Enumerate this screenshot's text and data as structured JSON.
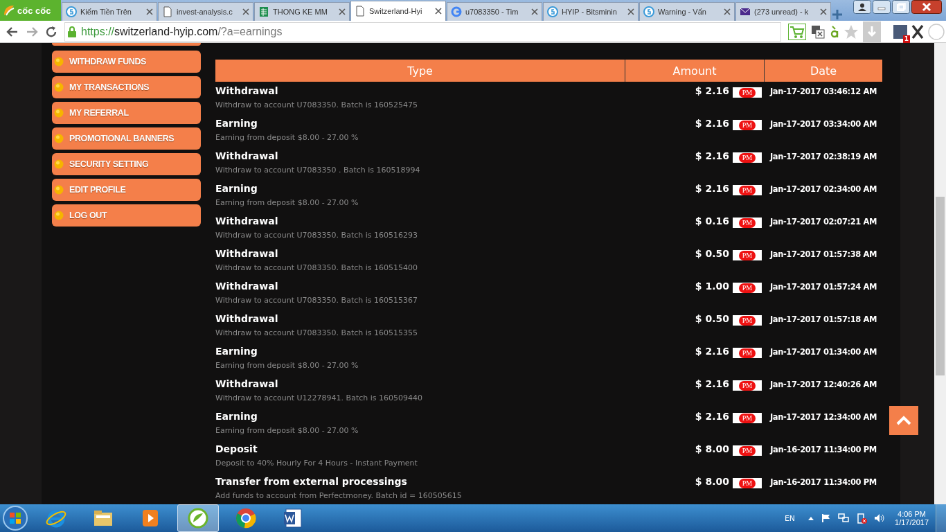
{
  "browser": {
    "logo": "cốc cốc",
    "tabs": [
      {
        "title": "Kiếm Tiền Trên",
        "kind": "coin",
        "selected": false
      },
      {
        "title": "invest-analysis.c",
        "kind": "page",
        "selected": false
      },
      {
        "title": "THONG KE MM",
        "kind": "sheet",
        "selected": false
      },
      {
        "title": "Switzerland-Hyi",
        "kind": "page",
        "selected": true
      },
      {
        "title": "u7083350 - Tim",
        "kind": "google",
        "selected": false
      },
      {
        "title": "HYIP - Bitsminin",
        "kind": "coin",
        "selected": false
      },
      {
        "title": "Warning - Vấn",
        "kind": "coin",
        "selected": false
      },
      {
        "title": "(273 unread) - k",
        "kind": "mail",
        "selected": false
      }
    ],
    "url": {
      "scheme": "https://",
      "host": "switzerland-hyip.com",
      "path": "/?a=earnings"
    },
    "extension_badge": "1"
  },
  "sidebar": {
    "items": [
      "WITHDRAW FUNDS",
      "MY TRANSACTIONS",
      "MY REFERRAL",
      "PROMOTIONAL BANNERS",
      "SECURITY SETTING",
      "EDIT PROFILE",
      "LOG OUT"
    ]
  },
  "table": {
    "columns": [
      "Type",
      "Amount",
      "Date"
    ],
    "rows": [
      {
        "type": "Withdrawal",
        "description": "Withdraw to account U7083350. Batch is 160525475",
        "amount": "$ 2.16",
        "method": "PM",
        "date": "Jan-17-2017 03:46:12 AM"
      },
      {
        "type": "Earning",
        "description": "Earning from deposit $8.00 - 27.00 %",
        "amount": "$ 2.16",
        "method": "PM",
        "date": "Jan-17-2017 03:34:00 AM"
      },
      {
        "type": "Withdrawal",
        "description": "Withdraw to account U7083350 . Batch is 160518994",
        "amount": "$ 2.16",
        "method": "PM",
        "date": "Jan-17-2017 02:38:19 AM"
      },
      {
        "type": "Earning",
        "description": "Earning from deposit $8.00 - 27.00 %",
        "amount": "$ 2.16",
        "method": "PM",
        "date": "Jan-17-2017 02:34:00 AM"
      },
      {
        "type": "Withdrawal",
        "description": "Withdraw to account U7083350. Batch is 160516293",
        "amount": "$ 0.16",
        "method": "PM",
        "date": "Jan-17-2017 02:07:21 AM"
      },
      {
        "type": "Withdrawal",
        "description": "Withdraw to account U7083350. Batch is 160515400",
        "amount": "$ 0.50",
        "method": "PM",
        "date": "Jan-17-2017 01:57:38 AM"
      },
      {
        "type": "Withdrawal",
        "description": "Withdraw to account U7083350. Batch is 160515367",
        "amount": "$ 1.00",
        "method": "PM",
        "date": "Jan-17-2017 01:57:24 AM"
      },
      {
        "type": "Withdrawal",
        "description": "Withdraw to account U7083350. Batch is 160515355",
        "amount": "$ 0.50",
        "method": "PM",
        "date": "Jan-17-2017 01:57:18 AM"
      },
      {
        "type": "Earning",
        "description": "Earning from deposit $8.00 - 27.00 %",
        "amount": "$ 2.16",
        "method": "PM",
        "date": "Jan-17-2017 01:34:00 AM"
      },
      {
        "type": "Withdrawal",
        "description": "Withdraw to account U12278941. Batch is 160509440",
        "amount": "$ 2.16",
        "method": "PM",
        "date": "Jan-17-2017 12:40:26 AM"
      },
      {
        "type": "Earning",
        "description": "Earning from deposit $8.00 - 27.00 %",
        "amount": "$ 2.16",
        "method": "PM",
        "date": "Jan-17-2017 12:34:00 AM"
      },
      {
        "type": "Deposit",
        "description": "Deposit to 40% Hourly For 4 Hours - Instant Payment",
        "amount": "$ 8.00",
        "method": "PM",
        "date": "Jan-16-2017 11:34:00 PM"
      },
      {
        "type": "Transfer from external processings",
        "description": "Add funds to account from Perfectmoney. Batch id = 160505615",
        "amount": "$ 8.00",
        "method": "PM",
        "date": "Jan-16-2017 11:34:00 PM"
      }
    ]
  },
  "taskbar": {
    "apps": [
      {
        "kind": "ie",
        "selected": false
      },
      {
        "kind": "folder",
        "selected": false
      },
      {
        "kind": "media",
        "selected": false
      },
      {
        "kind": "coccoc",
        "selected": true
      },
      {
        "kind": "chrome",
        "selected": false
      },
      {
        "kind": "word",
        "selected": false
      }
    ],
    "language": "EN",
    "time": "4:06 PM",
    "date": "1/17/2017"
  }
}
